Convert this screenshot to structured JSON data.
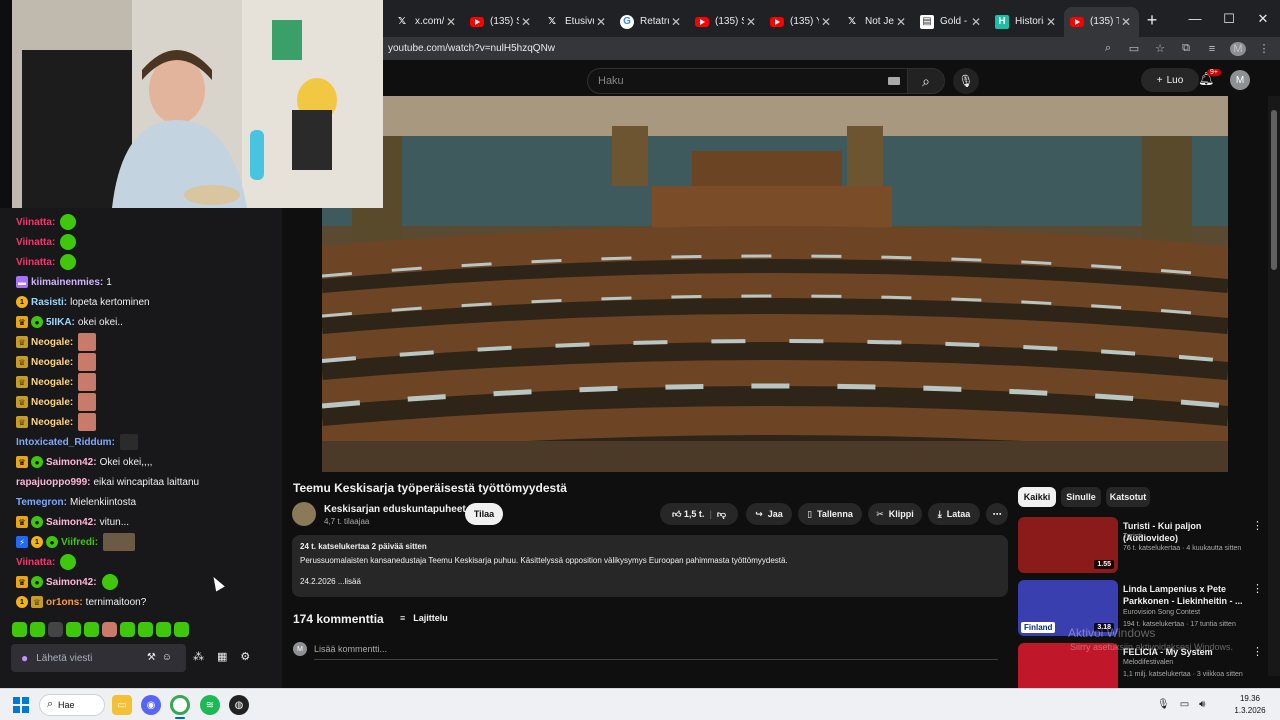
{
  "browser": {
    "tabs": [
      {
        "label": "x.com/i",
        "icon": "x-icon"
      },
      {
        "label": "(135) Sc",
        "icon": "youtube-icon"
      },
      {
        "label": "Etusivu",
        "icon": "x-icon"
      },
      {
        "label": "Retatrut",
        "icon": "google-icon"
      },
      {
        "label": "(135) St",
        "icon": "youtube-icon"
      },
      {
        "label": "(135) Yo",
        "icon": "youtube-icon"
      },
      {
        "label": "Not Jen",
        "icon": "x-icon"
      },
      {
        "label": "Gold - I",
        "icon": "gold-icon"
      },
      {
        "label": "Historia",
        "icon": "historia-icon"
      },
      {
        "label": "(135) Te",
        "icon": "youtube-icon"
      }
    ],
    "active_tab": 9,
    "url": "youtube.com/watch?v=nulH5hzqQNw",
    "profile_initial": "M"
  },
  "youtube": {
    "search_placeholder": "Haku",
    "create_label": "Luo",
    "notifications_badge": "9+",
    "avatar_initial": "M",
    "video": {
      "title": "Teemu Keskisarja työperäisestä työttömyydestä",
      "channel": "Keskisarjan eduskuntapuheet",
      "subscribers": "4,7 t. tilaajaa",
      "subscribe_label": "Tilaa",
      "likes": "1,5 t.",
      "share_label": "Jaa",
      "save_label": "Tallenna",
      "clip_label": "Klippi",
      "download_label": "Lataa",
      "description_meta": "24 t. katselukertaa  2 päivää sitten",
      "description_body": "Perussuomalaisten kansanedustaja Teemu Keskisarja puhuu. Käsittelyssä opposition välikysymys Euroopan pahimmasta työttömyydestä.",
      "description_more": "24.2.2026 ...lisää"
    },
    "comments": {
      "count_label": "174 kommenttia",
      "sort_label": "Lajittelu",
      "add_placeholder": "Lisää kommentti...",
      "avatar_initial": "M"
    },
    "chips": [
      "Kaikki",
      "Sinulle",
      "Katsotut"
    ],
    "recommendations": [
      {
        "title": "Turisti - Kui paljon (Audiovideo)",
        "channel": "Turisti",
        "meta": "76 t. katselukertaa · 4 kuukautta sitten",
        "duration": "1.55",
        "thumb_color": "#8b1a1a"
      },
      {
        "title": "Linda Lampenius x Pete Parkkonen - Liekinheitin - ...",
        "channel": "Eurovision Song Contest",
        "meta": "194 t. katselukertaa · 17 tuntia sitten",
        "duration": "3.18",
        "badge": "Finland",
        "thumb_color": "#3a3fb0"
      },
      {
        "title": "FELICIA - My System",
        "channel": "Melodifestivalen",
        "meta": "1,1 milj. katselukertaa · 3 viikkoa sitten",
        "duration": "",
        "thumb_color": "#c0172a"
      }
    ]
  },
  "chat": {
    "messages": [
      {
        "user": "Viinatta:",
        "color": "#ff2f6d",
        "badges": [],
        "text": "",
        "emote": "green"
      },
      {
        "user": "Viinatta:",
        "color": "#ff2f6d",
        "badges": [],
        "text": "",
        "emote": "green"
      },
      {
        "user": "Viinatta:",
        "color": "#ff2f6d",
        "badges": [],
        "text": "",
        "emote": "green"
      },
      {
        "user": "kiimainenmies:",
        "color": "#d2b4ff",
        "badges": [
          "purple"
        ],
        "text": "1",
        "emote": ""
      },
      {
        "user": "Rasisti:",
        "color": "#9ad7ff",
        "badges": [
          "gold"
        ],
        "text": "lopeta kertominen",
        "emote": ""
      },
      {
        "user": "5IIKA:",
        "color": "#9ad7ff",
        "badges": [
          "crown",
          "green"
        ],
        "text": "okei okei..",
        "emote": ""
      },
      {
        "user": "Neogale:",
        "color": "#ffd37a",
        "badges": [
          "cup"
        ],
        "text": "",
        "emote": "face"
      },
      {
        "user": "Neogale:",
        "color": "#ffd37a",
        "badges": [
          "cup"
        ],
        "text": "",
        "emote": "face"
      },
      {
        "user": "Neogale:",
        "color": "#ffd37a",
        "badges": [
          "cup"
        ],
        "text": "",
        "emote": "face"
      },
      {
        "user": "Neogale:",
        "color": "#ffd37a",
        "badges": [
          "cup"
        ],
        "text": "",
        "emote": "face"
      },
      {
        "user": "Neogale:",
        "color": "#ffd37a",
        "badges": [
          "cup"
        ],
        "text": "",
        "emote": "face"
      },
      {
        "user": "Intoxicated_Riddum:",
        "color": "#7fa8ff",
        "badges": [],
        "text": "",
        "emote": "dark"
      },
      {
        "user": "Saimon42:",
        "color": "#ffb6d3",
        "badges": [
          "crown",
          "green"
        ],
        "text": "Okei okei,,,,",
        "emote": ""
      },
      {
        "user": "rapajuoppo999:",
        "color": "#ffb6d3",
        "badges": [],
        "text": "eikai wincapitaa laittanu",
        "emote": ""
      },
      {
        "user": "Temegron:",
        "color": "#7fa8ff",
        "badges": [],
        "text": "Mielenkiintosta",
        "emote": ""
      },
      {
        "user": "Saimon42:",
        "color": "#ffb6d3",
        "badges": [
          "crown",
          "green"
        ],
        "text": "vitun...",
        "emote": ""
      },
      {
        "user": "Viifredi:",
        "color": "#3ec70b",
        "badges": [
          "blue",
          "gold",
          "green"
        ],
        "text": "",
        "emote": "wide"
      },
      {
        "user": "Viinatta:",
        "color": "#ff2f6d",
        "badges": [],
        "text": "",
        "emote": "green"
      },
      {
        "user": "Saimon42:",
        "color": "#ffb6d3",
        "badges": [
          "crown",
          "green"
        ],
        "text": "",
        "emote": "green"
      },
      {
        "user": "or1ons:",
        "color": "#ff9a3c",
        "badges": [
          "gold",
          "cup"
        ],
        "text": "ternimaitoon?",
        "emote": ""
      }
    ],
    "input_placeholder": "Lähetä viesti"
  },
  "watermark": {
    "line1": "Aktivoi Windows",
    "line2": "Siirry asetuksiin aktivoidaksesi Windows."
  },
  "taskbar": {
    "search_label": "Hae",
    "time": "19.36",
    "date": "1.3.2026"
  }
}
